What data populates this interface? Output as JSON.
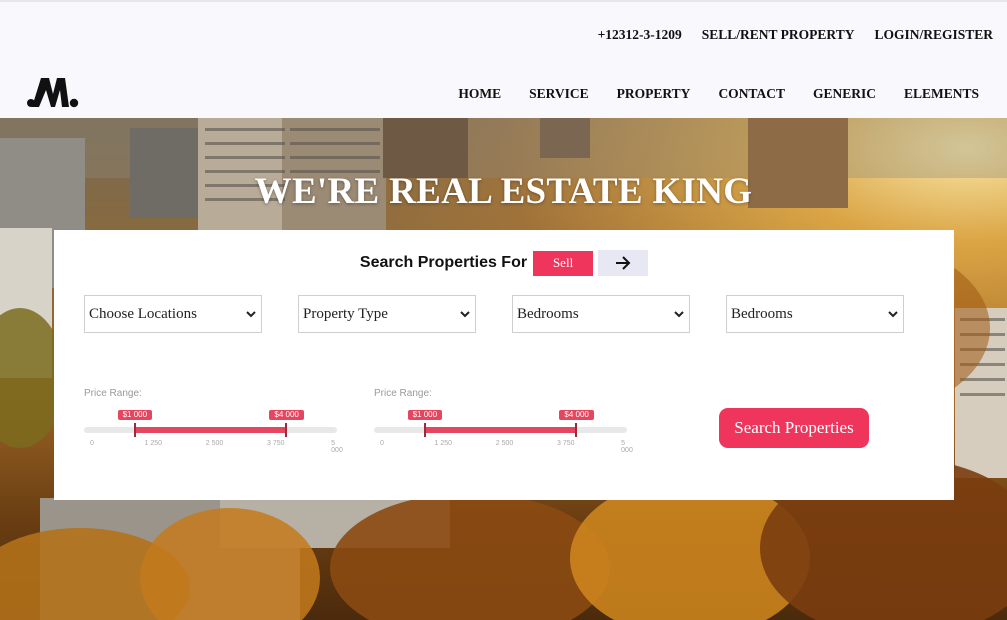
{
  "header": {
    "phone": "+12312-3-1209",
    "sell_rent": "SELL/RENT PROPERTY",
    "login": "LOGIN/REGISTER",
    "logo_text": "M.",
    "nav": [
      "HOME",
      "SERVICE",
      "PROPERTY",
      "CONTACT",
      "GENERIC",
      "ELEMENTS"
    ]
  },
  "hero": {
    "title": "WE'RE REAL ESTATE KING"
  },
  "search": {
    "label": "Search Properties For",
    "mode": "Sell",
    "arrow_icon": "arrow-right-icon",
    "selects": [
      "Choose Locations",
      "Property Type",
      "Bedrooms",
      "Bedrooms"
    ],
    "ranges": [
      {
        "label": "Price Range:",
        "low_label": "$1 000",
        "high_label": "$4 000",
        "min": 0,
        "max": 5000,
        "low": 1000,
        "high": 4000,
        "ticks": [
          "0",
          "1 250",
          "2 500",
          "3 750",
          "5 000"
        ]
      },
      {
        "label": "Price Range:",
        "low_label": "$1 000",
        "high_label": "$4 000",
        "min": 0,
        "max": 5000,
        "low": 1000,
        "high": 4000,
        "ticks": [
          "0",
          "1 250",
          "2 500",
          "3 750",
          "5 000"
        ]
      }
    ],
    "button": "Search Properties"
  },
  "colors": {
    "accent": "#f0355c",
    "topbar": "#f8f8fd"
  }
}
